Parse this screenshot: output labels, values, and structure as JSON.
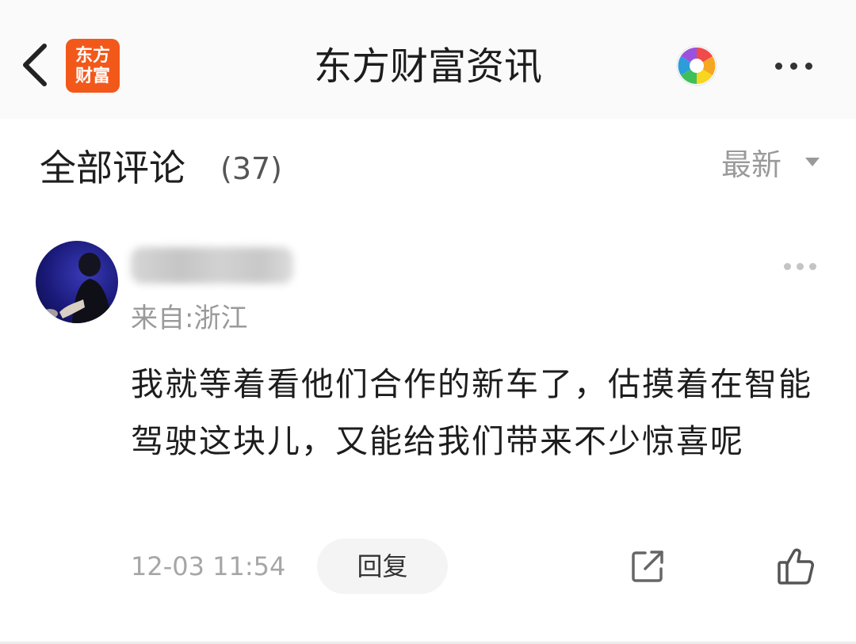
{
  "header": {
    "logo_line1": "东方",
    "logo_line2": "财富",
    "title": "东方财富资讯",
    "logo_color": "#f3581b"
  },
  "comments_section": {
    "title": "全部评论",
    "count": "(37)",
    "sort_label": "最新"
  },
  "comment": {
    "location": "来自:浙江",
    "text": "我就等着看他们合作的新车了，估摸着在智能驾驶这块儿，又能给我们带来不少惊喜呢",
    "timestamp": "12-03 11:54",
    "reply_label": "回复"
  },
  "icons": {
    "back": "chevron-left-icon",
    "app": "camera-aperture-icon",
    "more": "more-horizontal-icon",
    "share": "share-icon",
    "like": "thumbs-up-icon"
  }
}
